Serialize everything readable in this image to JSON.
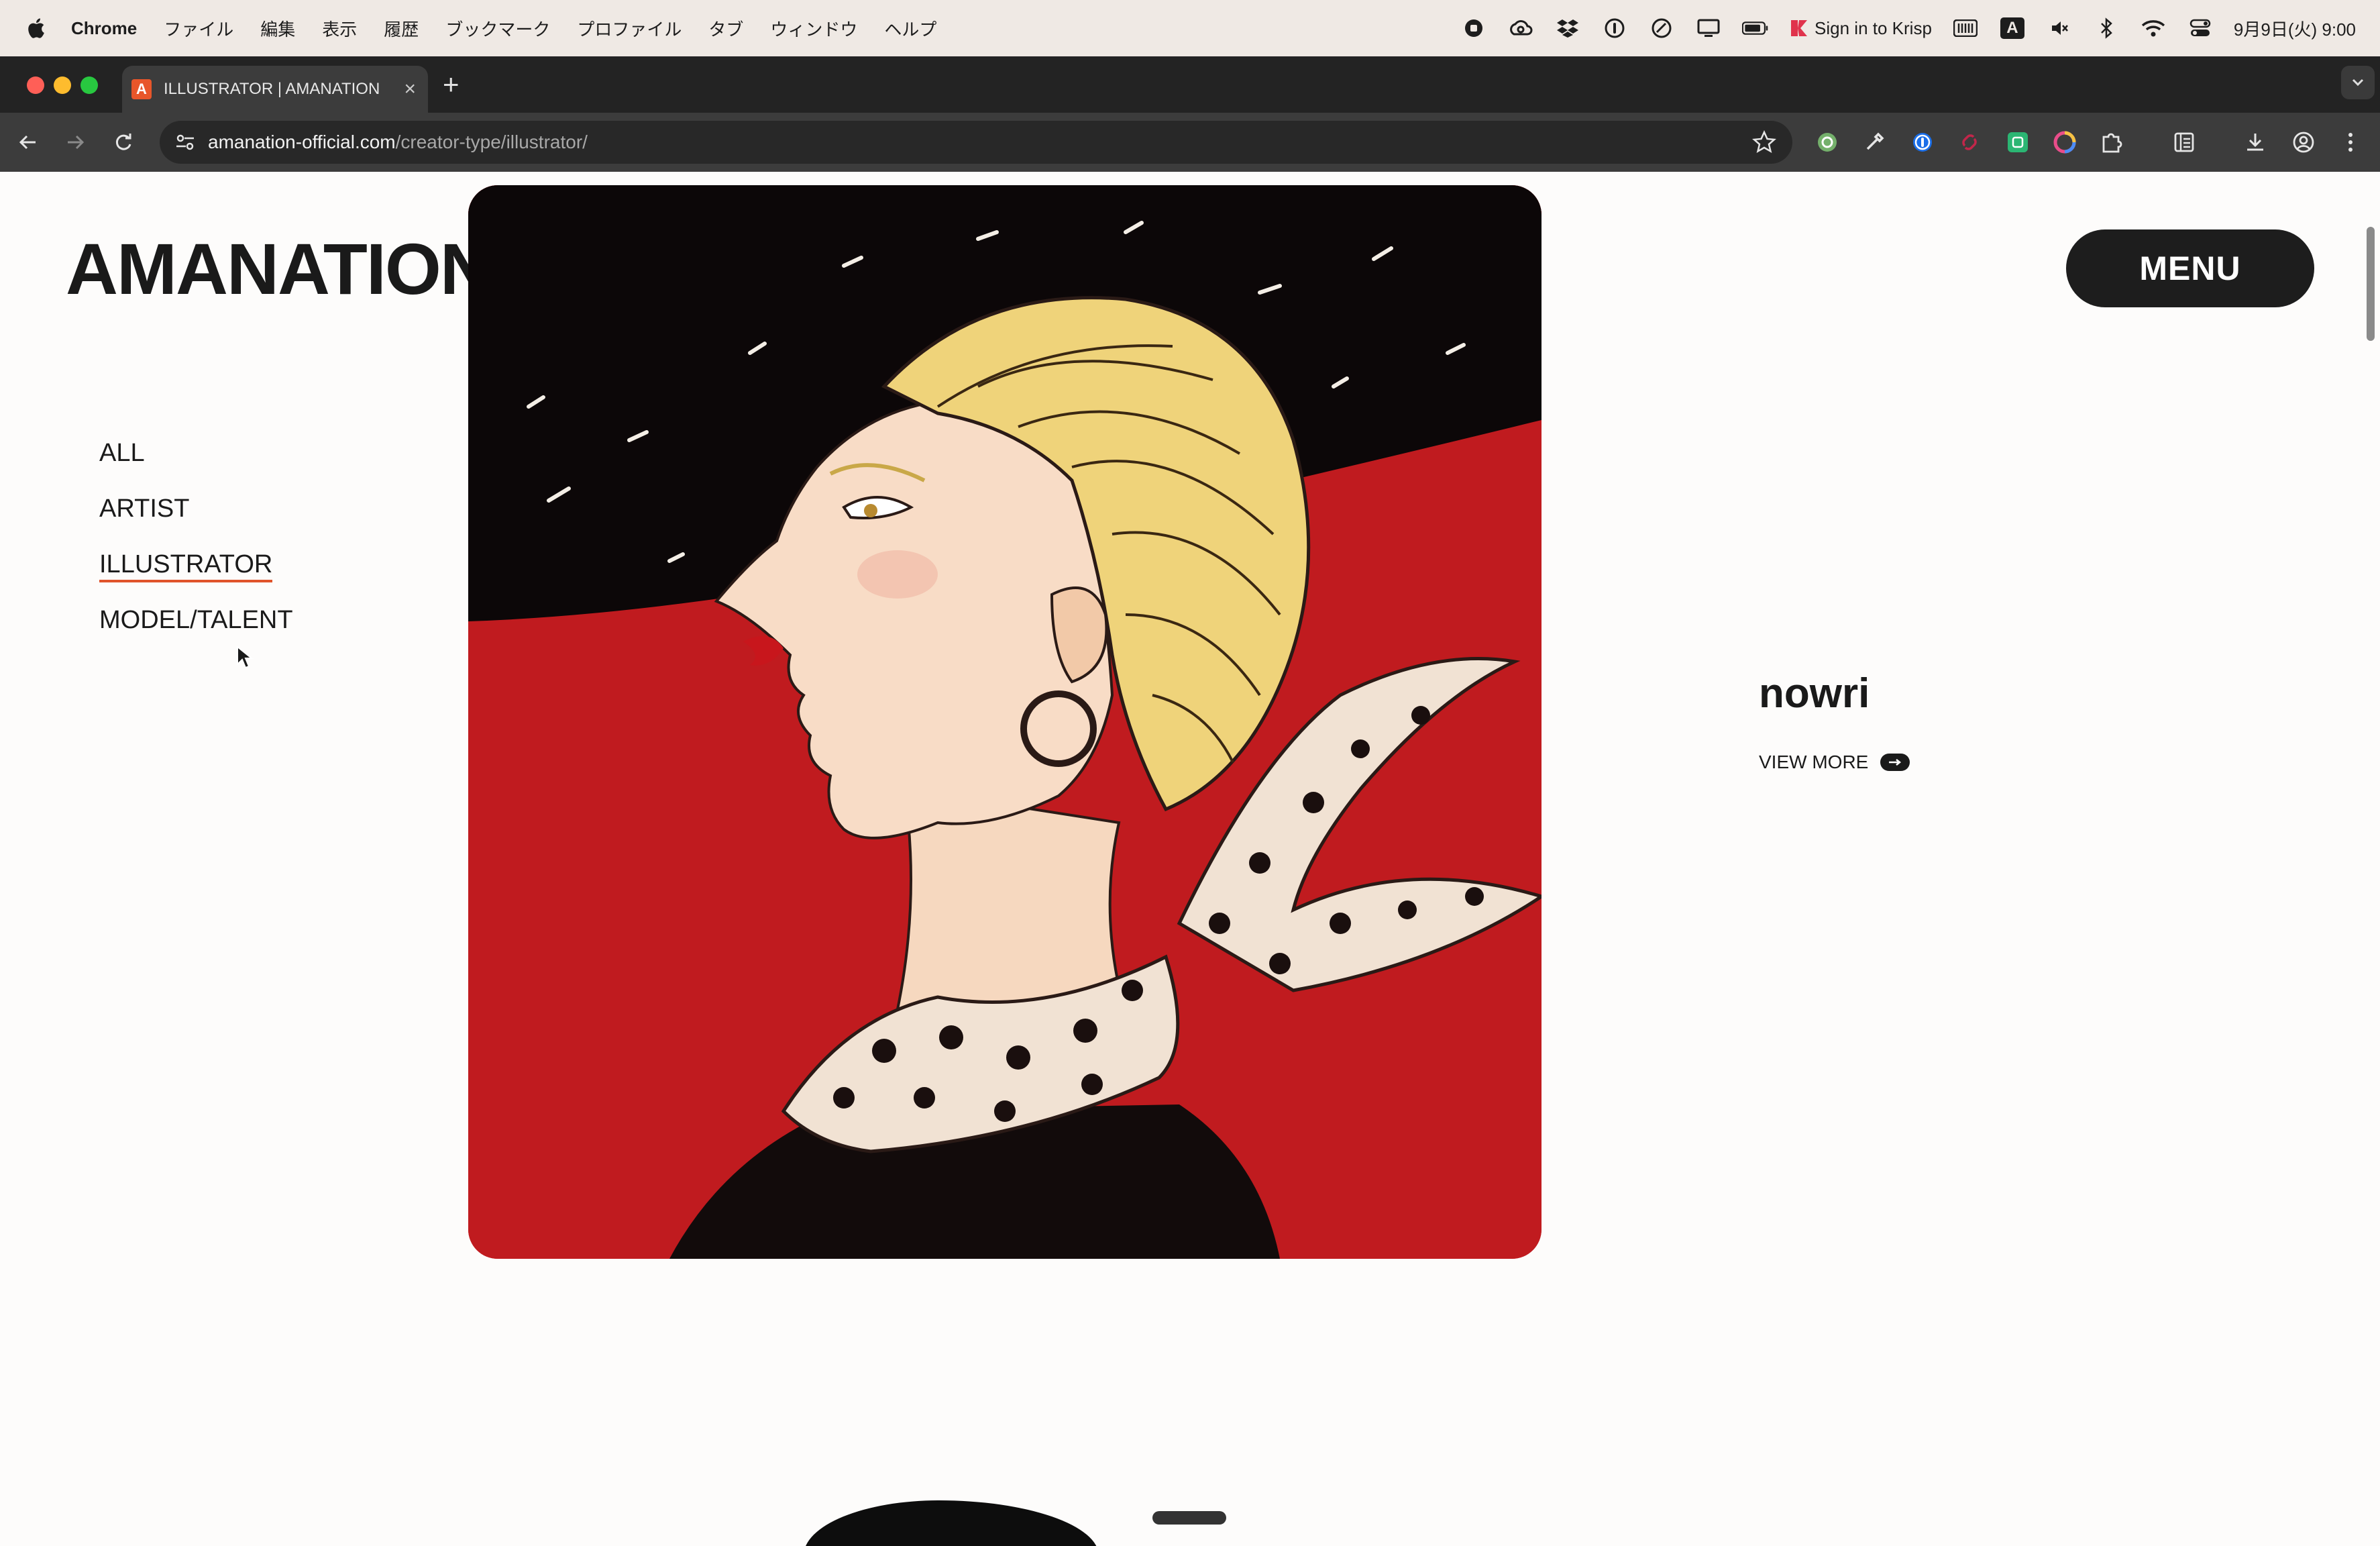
{
  "menubar": {
    "app_name": "Chrome",
    "items": [
      "ファイル",
      "編集",
      "表示",
      "履歴",
      "ブックマーク",
      "プロファイル",
      "タブ",
      "ウィンドウ",
      "ヘルプ"
    ],
    "krisp_label": "Sign in to Krisp",
    "clock": "9月9日(火) 9:00",
    "tray_icons": [
      "record-icon",
      "creative-cloud-icon",
      "dropbox-icon",
      "onepassword-icon",
      "clockify-icon",
      "display-icon",
      "battery-icon",
      "krisp-icon",
      "keyboard-icon",
      "input-source-icon",
      "mute-icon",
      "bluetooth-icon",
      "wifi-icon",
      "control-center-icon"
    ],
    "input_source_label": "A"
  },
  "browser": {
    "tab_title": "ILLUSTRATOR | AMANATION",
    "favicon_letter": "A",
    "new_tab_label": "+",
    "url_domain": "amanation-official.com",
    "url_path": "/creator-type/illustrator/"
  },
  "page": {
    "logo": "AMANATION",
    "nav": [
      {
        "label": "ALL",
        "active": false
      },
      {
        "label": "ARTIST",
        "active": false
      },
      {
        "label": "ILLUSTRATOR",
        "active": true
      },
      {
        "label": "MODEL/TALENT",
        "active": false
      }
    ],
    "menu_label": "MENU",
    "featured_creator": {
      "name": "nowri",
      "view_more": "VIEW MORE"
    },
    "colors": {
      "accent_underline": "#e0542b",
      "hero_red": "#c01b1f",
      "dark": "#1d1d1d"
    }
  }
}
